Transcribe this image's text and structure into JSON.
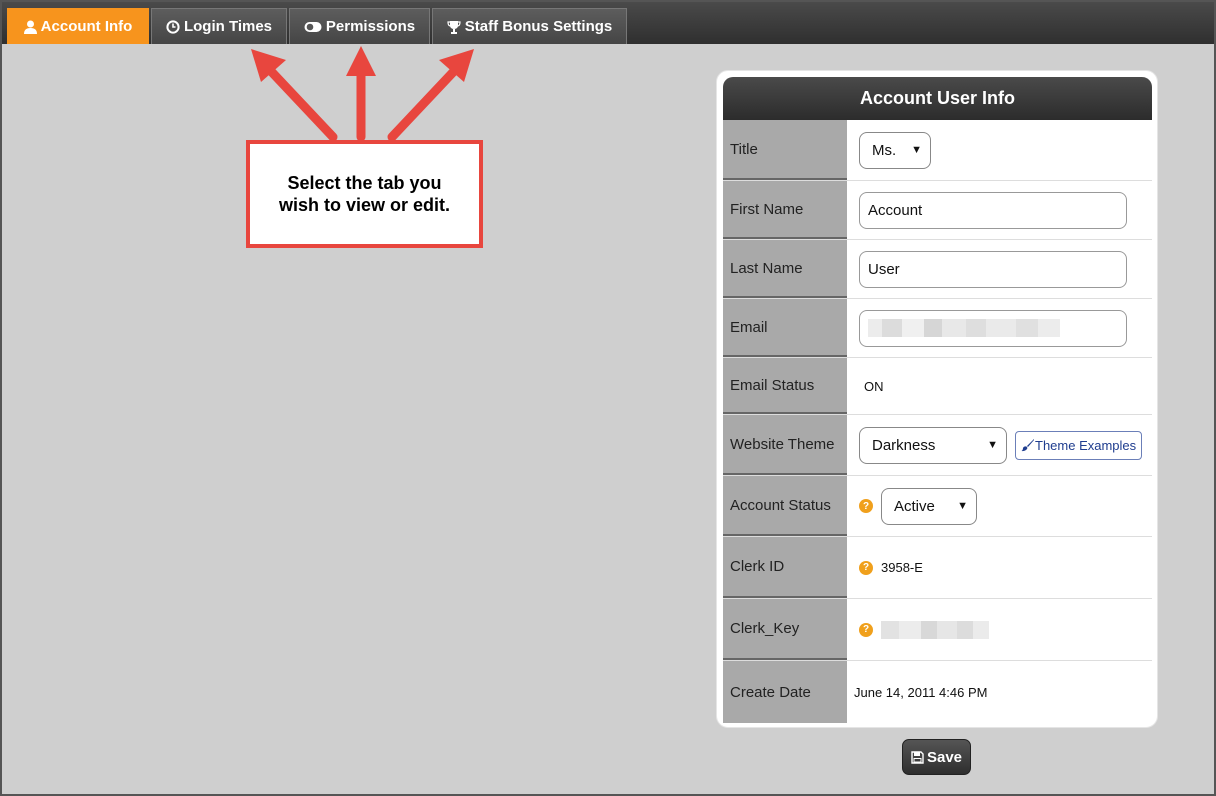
{
  "tabs": [
    {
      "label": "Account Info",
      "icon": "user-icon",
      "active": true
    },
    {
      "label": "Login Times",
      "icon": "clock-icon",
      "active": false
    },
    {
      "label": "Permissions",
      "icon": "toggle-icon",
      "active": false
    },
    {
      "label": "Staff Bonus Settings",
      "icon": "trophy-icon",
      "active": false
    }
  ],
  "callout": {
    "line1": "Select the tab you",
    "line2": "wish to view or edit."
  },
  "panel": {
    "title": "Account User Info",
    "fields": {
      "title": {
        "label": "Title",
        "value": "Ms."
      },
      "first_name": {
        "label": "First Name",
        "value": "Account"
      },
      "last_name": {
        "label": "Last Name",
        "value": "User"
      },
      "email": {
        "label": "Email"
      },
      "email_status": {
        "label": "Email Status",
        "value": "ON"
      },
      "website_theme": {
        "label": "Website Theme",
        "value": "Darkness",
        "button": "Theme Examples"
      },
      "account_status": {
        "label": "Account Status",
        "value": "Active"
      },
      "clerk_id": {
        "label": "Clerk ID",
        "value": "3958-E"
      },
      "clerk_key": {
        "label": "Clerk_Key"
      },
      "create_date": {
        "label": "Create Date",
        "value": "June 14, 2011 4:46 PM"
      }
    }
  },
  "save_label": "Save",
  "colors": {
    "accent": "#f7941d",
    "callout_border": "#e8463e",
    "help_icon": "#f0a01c"
  }
}
